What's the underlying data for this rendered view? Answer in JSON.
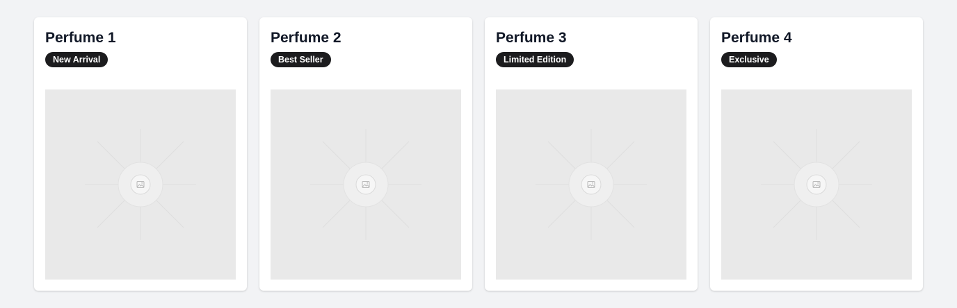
{
  "products": [
    {
      "name": "Perfume 1",
      "badge": "New Arrival",
      "image_icon": "image-placeholder-icon"
    },
    {
      "name": "Perfume 2",
      "badge": "Best Seller",
      "image_icon": "image-placeholder-icon"
    },
    {
      "name": "Perfume 3",
      "badge": "Limited Edition",
      "image_icon": "image-placeholder-icon"
    },
    {
      "name": "Perfume 4",
      "badge": "Exclusive",
      "image_icon": "image-placeholder-icon"
    }
  ],
  "colors": {
    "page_background": "#f2f3f5",
    "card_background": "#ffffff",
    "badge_background": "#1c1c1e",
    "badge_text": "#ffffff",
    "image_placeholder": "#e9e9e9"
  }
}
